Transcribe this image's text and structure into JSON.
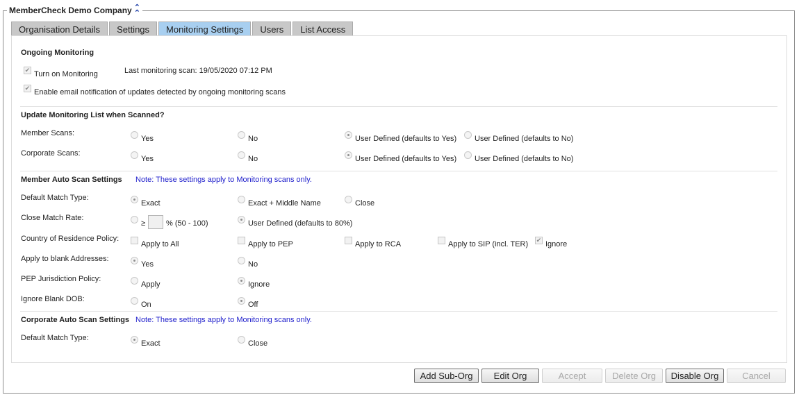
{
  "org": {
    "title": "MemberCheck Demo Company",
    "collapse_icon": "double-chevron-up-icon"
  },
  "tabs": [
    {
      "label": "Organisation Details",
      "active": false
    },
    {
      "label": "Settings",
      "active": false
    },
    {
      "label": "Monitoring Settings",
      "active": true
    },
    {
      "label": "Users",
      "active": false
    },
    {
      "label": "List Access",
      "active": false
    }
  ],
  "ongoing": {
    "title": "Ongoing Monitoring",
    "turn_on_label": "Turn on Monitoring",
    "turn_on_checked": true,
    "last_scan_label": "Last monitoring scan: 19/05/2020 07:12 PM",
    "email_label": "Enable email notification of updates detected by ongoing monitoring scans",
    "email_checked": true
  },
  "update_list": {
    "title": "Update Monitoring List when Scanned?",
    "member_label": "Member Scans:",
    "corporate_label": "Corporate Scans:",
    "options": [
      "Yes",
      "No",
      "User Defined (defaults to Yes)",
      "User Defined (defaults to No)"
    ],
    "member_selected": "User Defined (defaults to Yes)",
    "corporate_selected": "User Defined (defaults to Yes)"
  },
  "member_auto": {
    "title": "Member Auto Scan Settings",
    "note": "Note: These settings apply to Monitoring scans only.",
    "match_type": {
      "label": "Default Match Type:",
      "options": [
        "Exact",
        "Exact + Middle Name",
        "Close"
      ],
      "selected": "Exact"
    },
    "close_rate": {
      "label": "Close Match Rate:",
      "symbol": "≥",
      "value": "",
      "range_label": "% (50 - 100)",
      "user_defined_label": "User Defined (defaults to 80%)",
      "selected": "User Defined (defaults to 80%)"
    },
    "residence": {
      "label": "Country of Residence Policy:",
      "options": [
        "Apply to All",
        "Apply to PEP",
        "Apply to RCA",
        "Apply to SIP (incl. TER)",
        "Ignore"
      ],
      "checked": [
        "Ignore"
      ]
    },
    "blank_addr": {
      "label": "Apply to blank Addresses:",
      "options": [
        "Yes",
        "No"
      ],
      "selected": "Yes"
    },
    "pep_juris": {
      "label": "PEP Jurisdiction Policy:",
      "options": [
        "Apply",
        "Ignore"
      ],
      "selected": "Ignore"
    },
    "blank_dob": {
      "label": "Ignore Blank DOB:",
      "options": [
        "On",
        "Off"
      ],
      "selected": "Off"
    }
  },
  "corporate_auto": {
    "title": "Corporate Auto Scan Settings",
    "note": "Note: These settings apply to Monitoring scans only.",
    "match_type": {
      "label": "Default Match Type:",
      "options": [
        "Exact",
        "Close"
      ],
      "selected": "Exact"
    }
  },
  "buttons": {
    "add_sub_org": "Add Sub-Org",
    "edit_org": "Edit Org",
    "accept": "Accept",
    "delete_org": "Delete Org",
    "disable_org": "Disable Org",
    "cancel": "Cancel"
  }
}
